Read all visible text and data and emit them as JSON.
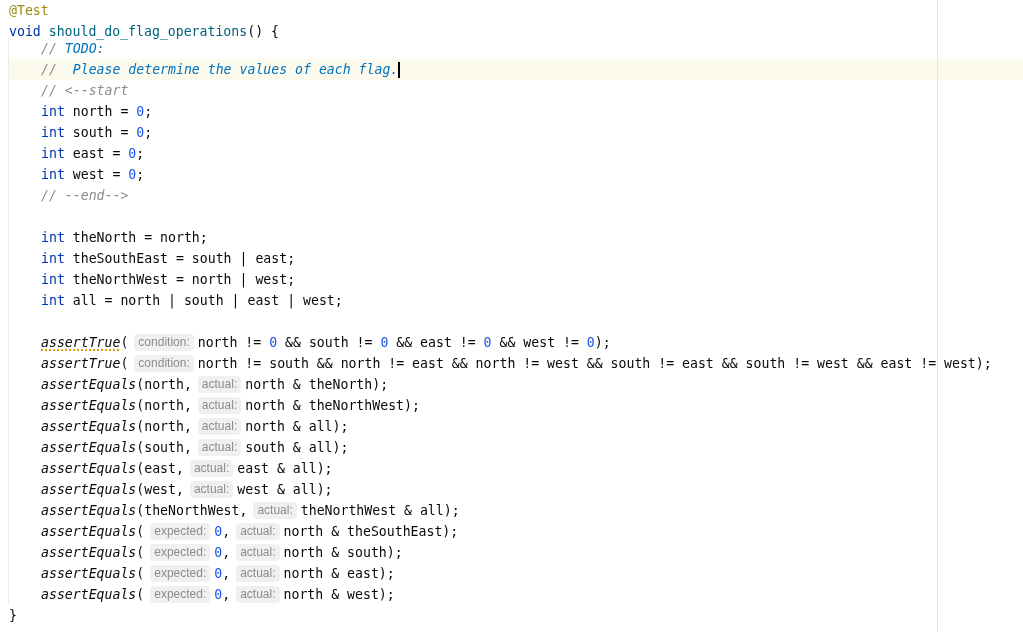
{
  "editor": {
    "method": {
      "annotation": "@Test",
      "signature": [
        {
          "kind": "kw",
          "text": "void "
        },
        {
          "kind": "method",
          "text": "should_do_flag_operations"
        },
        {
          "kind": "plain",
          "text": "() {"
        }
      ],
      "body": [
        {
          "kind": "code",
          "current": false,
          "caret": false,
          "tokens": [
            {
              "kind": "comment",
              "text": "// "
            },
            {
              "kind": "todo",
              "text": "TODO:"
            }
          ]
        },
        {
          "kind": "code",
          "current": true,
          "caret": true,
          "tokens": [
            {
              "kind": "comment",
              "text": "//"
            },
            {
              "kind": "todo",
              "text": "  Please determine the values of each flag."
            }
          ]
        },
        {
          "kind": "code",
          "current": false,
          "caret": false,
          "tokens": [
            {
              "kind": "comment",
              "text": "// <--start"
            }
          ]
        },
        {
          "kind": "code",
          "current": false,
          "caret": false,
          "tokens": [
            {
              "kind": "kw",
              "text": "int"
            },
            {
              "kind": "plain",
              "text": " north = "
            },
            {
              "kind": "num",
              "text": "0"
            },
            {
              "kind": "plain",
              "text": ";"
            }
          ]
        },
        {
          "kind": "code",
          "current": false,
          "caret": false,
          "tokens": [
            {
              "kind": "kw",
              "text": "int"
            },
            {
              "kind": "plain",
              "text": " south = "
            },
            {
              "kind": "num",
              "text": "0"
            },
            {
              "kind": "plain",
              "text": ";"
            }
          ]
        },
        {
          "kind": "code",
          "current": false,
          "caret": false,
          "tokens": [
            {
              "kind": "kw",
              "text": "int"
            },
            {
              "kind": "plain",
              "text": " east = "
            },
            {
              "kind": "num",
              "text": "0"
            },
            {
              "kind": "plain",
              "text": ";"
            }
          ]
        },
        {
          "kind": "code",
          "current": false,
          "caret": false,
          "tokens": [
            {
              "kind": "kw",
              "text": "int"
            },
            {
              "kind": "plain",
              "text": " west = "
            },
            {
              "kind": "num",
              "text": "0"
            },
            {
              "kind": "plain",
              "text": ";"
            }
          ]
        },
        {
          "kind": "code",
          "current": false,
          "caret": false,
          "tokens": [
            {
              "kind": "comment",
              "text": "// --end-->"
            }
          ]
        },
        {
          "kind": "blank"
        },
        {
          "kind": "code",
          "current": false,
          "caret": false,
          "tokens": [
            {
              "kind": "kw",
              "text": "int"
            },
            {
              "kind": "plain",
              "text": " theNorth = north;"
            }
          ]
        },
        {
          "kind": "code",
          "current": false,
          "caret": false,
          "tokens": [
            {
              "kind": "kw",
              "text": "int"
            },
            {
              "kind": "plain",
              "text": " theSouthEast = south | east;"
            }
          ]
        },
        {
          "kind": "code",
          "current": false,
          "caret": false,
          "tokens": [
            {
              "kind": "kw",
              "text": "int"
            },
            {
              "kind": "plain",
              "text": " theNorthWest = north | west;"
            }
          ]
        },
        {
          "kind": "code",
          "current": false,
          "caret": false,
          "tokens": [
            {
              "kind": "kw",
              "text": "int"
            },
            {
              "kind": "plain",
              "text": " all = north | south | east | west;"
            }
          ]
        },
        {
          "kind": "blank"
        },
        {
          "kind": "code",
          "current": false,
          "caret": false,
          "tokens": [
            {
              "kind": "call",
              "text": "assertTrue",
              "warning": true
            },
            {
              "kind": "plain",
              "text": "("
            },
            {
              "kind": "hint",
              "text": "condition:"
            },
            {
              "kind": "plain",
              "text": "north != "
            },
            {
              "kind": "num",
              "text": "0"
            },
            {
              "kind": "plain",
              "text": " && south != "
            },
            {
              "kind": "num",
              "text": "0"
            },
            {
              "kind": "plain",
              "text": " && east != "
            },
            {
              "kind": "num",
              "text": "0"
            },
            {
              "kind": "plain",
              "text": " && west != "
            },
            {
              "kind": "num",
              "text": "0"
            },
            {
              "kind": "plain",
              "text": ");"
            }
          ]
        },
        {
          "kind": "code",
          "current": false,
          "caret": false,
          "tokens": [
            {
              "kind": "call",
              "text": "assertTrue",
              "warning": false
            },
            {
              "kind": "plain",
              "text": "("
            },
            {
              "kind": "hint",
              "text": "condition:"
            },
            {
              "kind": "plain",
              "text": "north != south && north != east && north != west && south != east && south != west && east != west);"
            }
          ]
        },
        {
          "kind": "code",
          "current": false,
          "caret": false,
          "tokens": [
            {
              "kind": "call",
              "text": "assertEquals",
              "warning": false
            },
            {
              "kind": "plain",
              "text": "(north,"
            },
            {
              "kind": "hint",
              "text": "actual:"
            },
            {
              "kind": "plain",
              "text": "north & theNorth);"
            }
          ]
        },
        {
          "kind": "code",
          "current": false,
          "caret": false,
          "tokens": [
            {
              "kind": "call",
              "text": "assertEquals",
              "warning": false
            },
            {
              "kind": "plain",
              "text": "(north,"
            },
            {
              "kind": "hint",
              "text": "actual:"
            },
            {
              "kind": "plain",
              "text": "north & theNorthWest);"
            }
          ]
        },
        {
          "kind": "code",
          "current": false,
          "caret": false,
          "tokens": [
            {
              "kind": "call",
              "text": "assertEquals",
              "warning": false
            },
            {
              "kind": "plain",
              "text": "(north,"
            },
            {
              "kind": "hint",
              "text": "actual:"
            },
            {
              "kind": "plain",
              "text": "north & all);"
            }
          ]
        },
        {
          "kind": "code",
          "current": false,
          "caret": false,
          "tokens": [
            {
              "kind": "call",
              "text": "assertEquals",
              "warning": false
            },
            {
              "kind": "plain",
              "text": "(south,"
            },
            {
              "kind": "hint",
              "text": "actual:"
            },
            {
              "kind": "plain",
              "text": "south & all);"
            }
          ]
        },
        {
          "kind": "code",
          "current": false,
          "caret": false,
          "tokens": [
            {
              "kind": "call",
              "text": "assertEquals",
              "warning": false
            },
            {
              "kind": "plain",
              "text": "(east,"
            },
            {
              "kind": "hint",
              "text": "actual:"
            },
            {
              "kind": "plain",
              "text": "east & all);"
            }
          ]
        },
        {
          "kind": "code",
          "current": false,
          "caret": false,
          "tokens": [
            {
              "kind": "call",
              "text": "assertEquals",
              "warning": false
            },
            {
              "kind": "plain",
              "text": "(west,"
            },
            {
              "kind": "hint",
              "text": "actual:"
            },
            {
              "kind": "plain",
              "text": "west & all);"
            }
          ]
        },
        {
          "kind": "code",
          "current": false,
          "caret": false,
          "tokens": [
            {
              "kind": "call",
              "text": "assertEquals",
              "warning": false
            },
            {
              "kind": "plain",
              "text": "(theNorthWest,"
            },
            {
              "kind": "hint",
              "text": "actual:"
            },
            {
              "kind": "plain",
              "text": "theNorthWest & all);"
            }
          ]
        },
        {
          "kind": "code",
          "current": false,
          "caret": false,
          "tokens": [
            {
              "kind": "call",
              "text": "assertEquals",
              "warning": false
            },
            {
              "kind": "plain",
              "text": "("
            },
            {
              "kind": "hint",
              "text": "expected:"
            },
            {
              "kind": "num",
              "text": "0"
            },
            {
              "kind": "plain",
              "text": ","
            },
            {
              "kind": "hint",
              "text": "actual:"
            },
            {
              "kind": "plain",
              "text": "north & theSouthEast);"
            }
          ]
        },
        {
          "kind": "code",
          "current": false,
          "caret": false,
          "tokens": [
            {
              "kind": "call",
              "text": "assertEquals",
              "warning": false
            },
            {
              "kind": "plain",
              "text": "("
            },
            {
              "kind": "hint",
              "text": "expected:"
            },
            {
              "kind": "num",
              "text": "0"
            },
            {
              "kind": "plain",
              "text": ","
            },
            {
              "kind": "hint",
              "text": "actual:"
            },
            {
              "kind": "plain",
              "text": "north & south);"
            }
          ]
        },
        {
          "kind": "code",
          "current": false,
          "caret": false,
          "tokens": [
            {
              "kind": "call",
              "text": "assertEquals",
              "warning": false
            },
            {
              "kind": "plain",
              "text": "("
            },
            {
              "kind": "hint",
              "text": "expected:"
            },
            {
              "kind": "num",
              "text": "0"
            },
            {
              "kind": "plain",
              "text": ","
            },
            {
              "kind": "hint",
              "text": "actual:"
            },
            {
              "kind": "plain",
              "text": "north & east);"
            }
          ]
        },
        {
          "kind": "code",
          "current": false,
          "caret": false,
          "tokens": [
            {
              "kind": "call",
              "text": "assertEquals",
              "warning": false
            },
            {
              "kind": "plain",
              "text": "("
            },
            {
              "kind": "hint",
              "text": "expected:"
            },
            {
              "kind": "num",
              "text": "0"
            },
            {
              "kind": "plain",
              "text": ","
            },
            {
              "kind": "hint",
              "text": "actual:"
            },
            {
              "kind": "plain",
              "text": "north & west);"
            }
          ]
        }
      ],
      "closing": "}"
    }
  }
}
